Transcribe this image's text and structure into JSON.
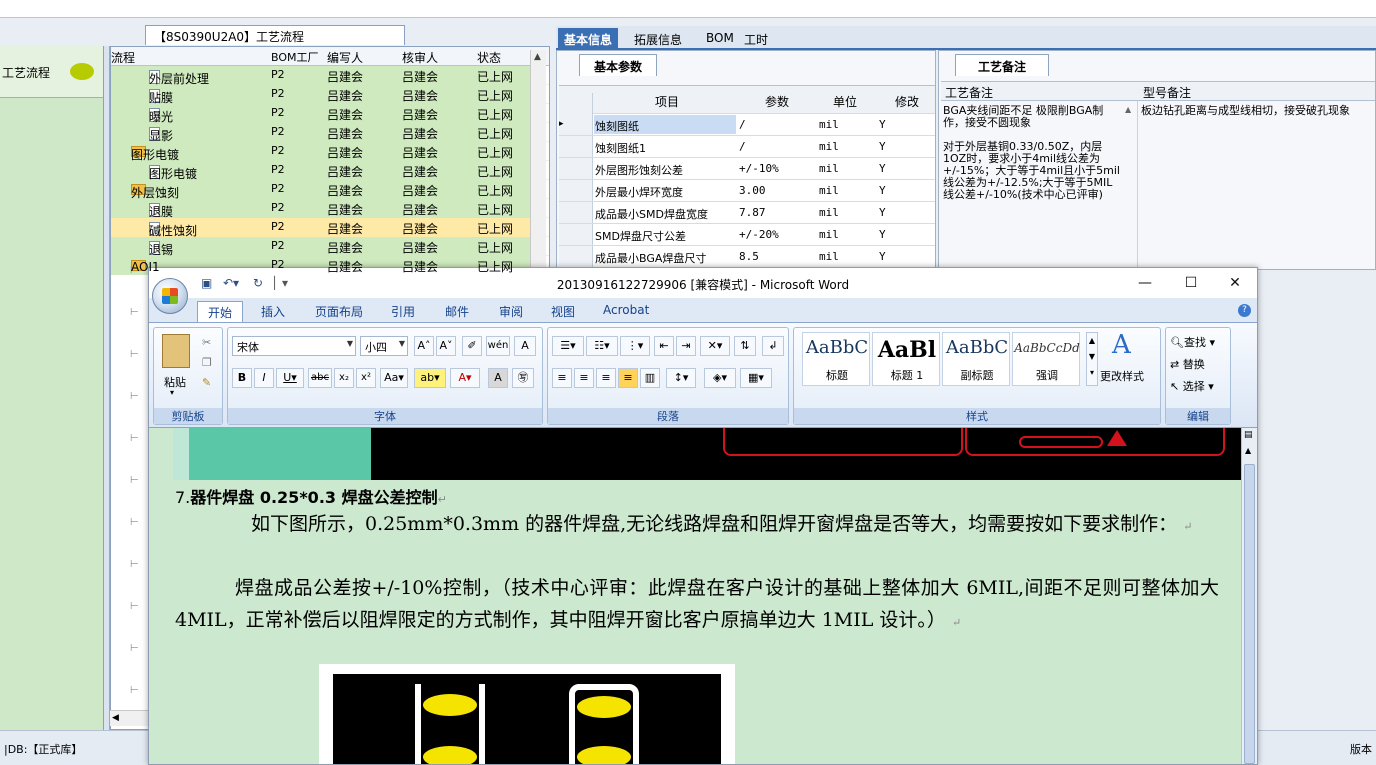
{
  "app": {
    "tree_title": "【8S0390U2A0】工艺流程",
    "left_panel_label": "工艺流程",
    "status_db": "|DB:【正式库】",
    "status_version": "版本",
    "tree_headers": [
      "流程",
      "BOM工厂",
      "编写人",
      "核审人",
      "状态"
    ],
    "tree_rows": [
      {
        "indent": 2,
        "icon": "file",
        "name": "外层前处理",
        "bom": "P2",
        "writer": "吕建会",
        "reviewer": "吕建会",
        "status": "已上网"
      },
      {
        "indent": 2,
        "icon": "file",
        "name": "贴膜",
        "bom": "P2",
        "writer": "吕建会",
        "reviewer": "吕建会",
        "status": "已上网"
      },
      {
        "indent": 2,
        "icon": "file",
        "name": "曝光",
        "bom": "P2",
        "writer": "吕建会",
        "reviewer": "吕建会",
        "status": "已上网"
      },
      {
        "indent": 2,
        "icon": "file",
        "name": "显影",
        "bom": "P2",
        "writer": "吕建会",
        "reviewer": "吕建会",
        "status": "已上网"
      },
      {
        "indent": 1,
        "icon": "folder",
        "name": "图形电镀",
        "bom": "P2",
        "writer": "吕建会",
        "reviewer": "吕建会",
        "status": "已上网"
      },
      {
        "indent": 2,
        "icon": "file",
        "name": "图形电镀",
        "bom": "P2",
        "writer": "吕建会",
        "reviewer": "吕建会",
        "status": "已上网"
      },
      {
        "indent": 1,
        "icon": "folder",
        "name": "外层蚀刻",
        "bom": "P2",
        "writer": "吕建会",
        "reviewer": "吕建会",
        "status": "已上网"
      },
      {
        "indent": 2,
        "icon": "file",
        "name": "退膜",
        "bom": "P2",
        "writer": "吕建会",
        "reviewer": "吕建会",
        "status": "已上网"
      },
      {
        "indent": 2,
        "icon": "file",
        "name": "碱性蚀刻",
        "bom": "P2",
        "writer": "吕建会",
        "reviewer": "吕建会",
        "status": "已上网",
        "selected": true
      },
      {
        "indent": 2,
        "icon": "file",
        "name": "退锡",
        "bom": "P2",
        "writer": "吕建会",
        "reviewer": "吕建会",
        "status": "已上网"
      },
      {
        "indent": 1,
        "icon": "folder",
        "name": "AOI1",
        "bom": "P2",
        "writer": "吕建会",
        "reviewer": "吕建会",
        "status": "已上网"
      }
    ],
    "top_tabs": [
      "基本信息",
      "拓展信息",
      "BOM",
      "工时"
    ],
    "basic_params_tab": "基本参数",
    "param_headers": [
      "项目",
      "参数",
      "单位",
      "修改"
    ],
    "param_rows": [
      {
        "item": "蚀刻图纸",
        "value": "/",
        "unit": "mil",
        "mod": "Y"
      },
      {
        "item": "蚀刻图纸1",
        "value": "/",
        "unit": "mil",
        "mod": "Y"
      },
      {
        "item": "外层图形蚀刻公差",
        "value": "+/-10%",
        "unit": "mil",
        "mod": "Y"
      },
      {
        "item": "外层最小焊环宽度",
        "value": "3.00",
        "unit": "mil",
        "mod": "Y"
      },
      {
        "item": "成品最小SMD焊盘宽度",
        "value": "7.87",
        "unit": "mil",
        "mod": "Y"
      },
      {
        "item": "SMD焊盘尺寸公差",
        "value": "+/-20%",
        "unit": "mil",
        "mod": "Y"
      },
      {
        "item": "成品最小BGA焊盘尺寸",
        "value": "8.5",
        "unit": "mil",
        "mod": "Y"
      }
    ],
    "remark_tab": "工艺备注",
    "remark_headers": [
      "工艺备注",
      "型号备注"
    ],
    "remark_text": "BGA夹线间距不足 极限削BGA制作，接受不圆现象\n\n对于外层基铜0.33/0.50Z，内层1OZ时，要求小于4mil线公差为+/-15%；大于等于4mil且小于5mil线公差为+/-12.5%;大于等于5MIL线公差+/-10%(技术中心已评审)",
    "model_remark_text": "板边钻孔距离与成型线相切，接受破孔现象"
  },
  "word": {
    "title": "20130916122729906 [兼容模式] - Microsoft Word",
    "tabs": [
      "开始",
      "插入",
      "页面布局",
      "引用",
      "邮件",
      "审阅",
      "视图",
      "Acrobat"
    ],
    "font_name": "宋体",
    "font_size": "小四",
    "groups": [
      "剪贴板",
      "字体",
      "段落",
      "样式",
      "编辑"
    ],
    "paste_label": "粘贴",
    "styles": [
      {
        "sample": "AaBbC",
        "name": "标题"
      },
      {
        "sample": "AaBl",
        "name": "标题 1"
      },
      {
        "sample": "AaBbC",
        "name": "副标题"
      },
      {
        "sample": "AaBbCcDd",
        "name": "强调"
      }
    ],
    "change_styles": "更改样式",
    "find": "查找",
    "replace": "替换",
    "select": "选择",
    "heading_prefix": "7.",
    "heading_bold": "器件焊盘 0.25*0.3 焊盘公差控制",
    "para1": "如下图所示，0.25mm*0.3mm 的器件焊盘,无论线路焊盘和阻焊开窗焊盘是否等大，均需要按如下要求制作：",
    "para2": "焊盘成品公差按+/-10%控制，（技术中心评审：此焊盘在客户设计的基础上整体加大 6MIL,间距不足则可整体加大 4MIL，正常补偿后以阻焊限定的方式制作，其中阻焊开窗比客户原搞单边大 1MIL 设计。）"
  }
}
